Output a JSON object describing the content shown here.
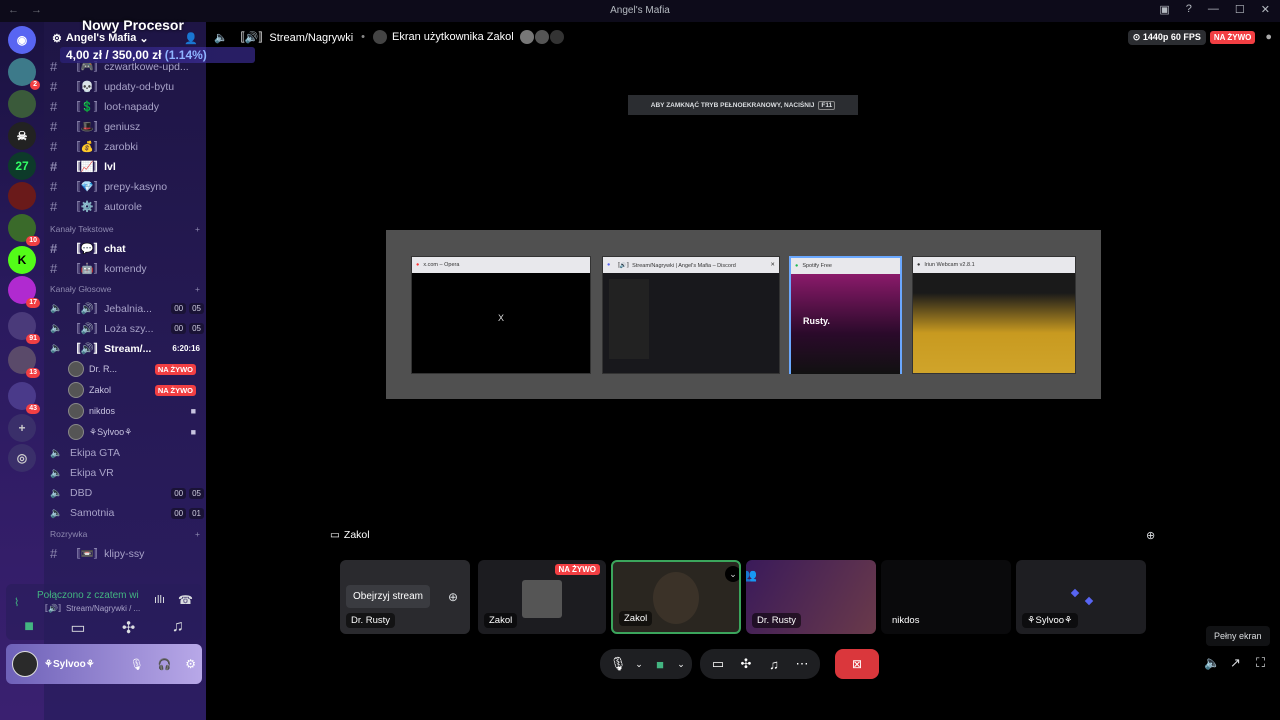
{
  "window": {
    "title": "Angel's Mafia"
  },
  "overlay": {
    "title": "Nowy Procesor",
    "current": "4,00 zł",
    "sep": "/",
    "goal": "350,00 zł",
    "pct": "(1.14%)"
  },
  "server": {
    "name": "Angel's Mafia"
  },
  "server_badges": [
    "2",
    "10",
    "17",
    "91",
    "13",
    "43"
  ],
  "channels_top": [
    {
      "label": "〚🎮〛czwartkowe-upd...",
      "bold": false
    },
    {
      "label": "〚💀〛updaty-od-bytu",
      "bold": false
    },
    {
      "label": "〚💲〛loot-napady",
      "bold": false
    },
    {
      "label": "〚🎩〛geniusz",
      "bold": false
    },
    {
      "label": "〚💰〛zarobki",
      "bold": false
    },
    {
      "label": "〚📈〛lvl",
      "bold": true
    },
    {
      "label": "〚💎〛prepy-kasyno",
      "bold": false
    },
    {
      "label": "〚⚙️〛autorole",
      "bold": false
    }
  ],
  "cat_text": "Kanały Tekstowe",
  "text_channels": [
    {
      "label": "〚💬〛chat",
      "bold": true
    },
    {
      "label": "〚🤖〛komendy",
      "bold": false
    }
  ],
  "cat_voice": "Kanały Głosowe",
  "voice_channels_a": [
    {
      "label": "〚🔊〛Jebalnia...",
      "c1": "00",
      "c2": "05"
    },
    {
      "label": "〚🔊〛Loża szy...",
      "c1": "00",
      "c2": "05"
    }
  ],
  "stream_channel": {
    "label": "〚🔊〛Stream/...",
    "time": "6:20:16"
  },
  "voice_users": [
    {
      "name": "Dr. R...",
      "live": "NA ŻYWO"
    },
    {
      "name": "Zakol",
      "live": "NA ŻYWO"
    },
    {
      "name": "nikdos",
      "live": ""
    },
    {
      "name": "⚘Sylvoo⚘",
      "live": ""
    }
  ],
  "voice_channels_b": [
    {
      "label": "Ekipa GTA",
      "c1": "",
      "c2": ""
    },
    {
      "label": "Ekipa VR",
      "c1": "",
      "c2": ""
    },
    {
      "label": "DBD",
      "c1": "00",
      "c2": "05"
    },
    {
      "label": "Samotnia",
      "c1": "00",
      "c2": "01"
    }
  ],
  "cat_fun": "Rozrywka",
  "fun_channels": [
    {
      "label": "〚📼〛klipy-ssy"
    }
  ],
  "voice_status": {
    "title": "Połączono z czatem wi",
    "sub": "〚🔊〛Stream/Nagrywki / ..."
  },
  "user_panel": {
    "name": "⚘Sylvoo⚘"
  },
  "topbar": {
    "channel": "〚🔊〛Stream/Nagrywki",
    "screen": "Ekran użytkownika Zakol",
    "quality": "1440p 60 FPS",
    "live": "NA ŻYWO"
  },
  "fullscreen_hint": {
    "text": "ABY ZAMKNĄĆ TRYB PEŁNOEKRANOWY, NACIŚNIJ",
    "key": "F11"
  },
  "picker": [
    {
      "title": "x.com – Opera",
      "content": "X"
    },
    {
      "title": "〚🔊〛Stream/Nagrywki | Angel's Mafia – Discord",
      "content": ""
    },
    {
      "title": "Spotify Free",
      "content": "Rusty."
    },
    {
      "title": "Iriun Webcam v2.8.1",
      "content": ""
    }
  ],
  "stage_label": "Zakol",
  "tiles": [
    {
      "label": "Dr. Rusty",
      "button": "Obejrzyj stream"
    },
    {
      "label": "Zakol",
      "live": "NA ŻYWO"
    },
    {
      "label": "Zakol"
    },
    {
      "label": "Dr. Rusty"
    },
    {
      "label": "nikdos"
    },
    {
      "label": "⚘Sylvoo⚘"
    }
  ],
  "tooltip": "Pełny ekran",
  "colors": {
    "accent": "#5865f2",
    "live": "#f23f43",
    "sidebar": "#261a55",
    "end_call": "#da373c"
  }
}
